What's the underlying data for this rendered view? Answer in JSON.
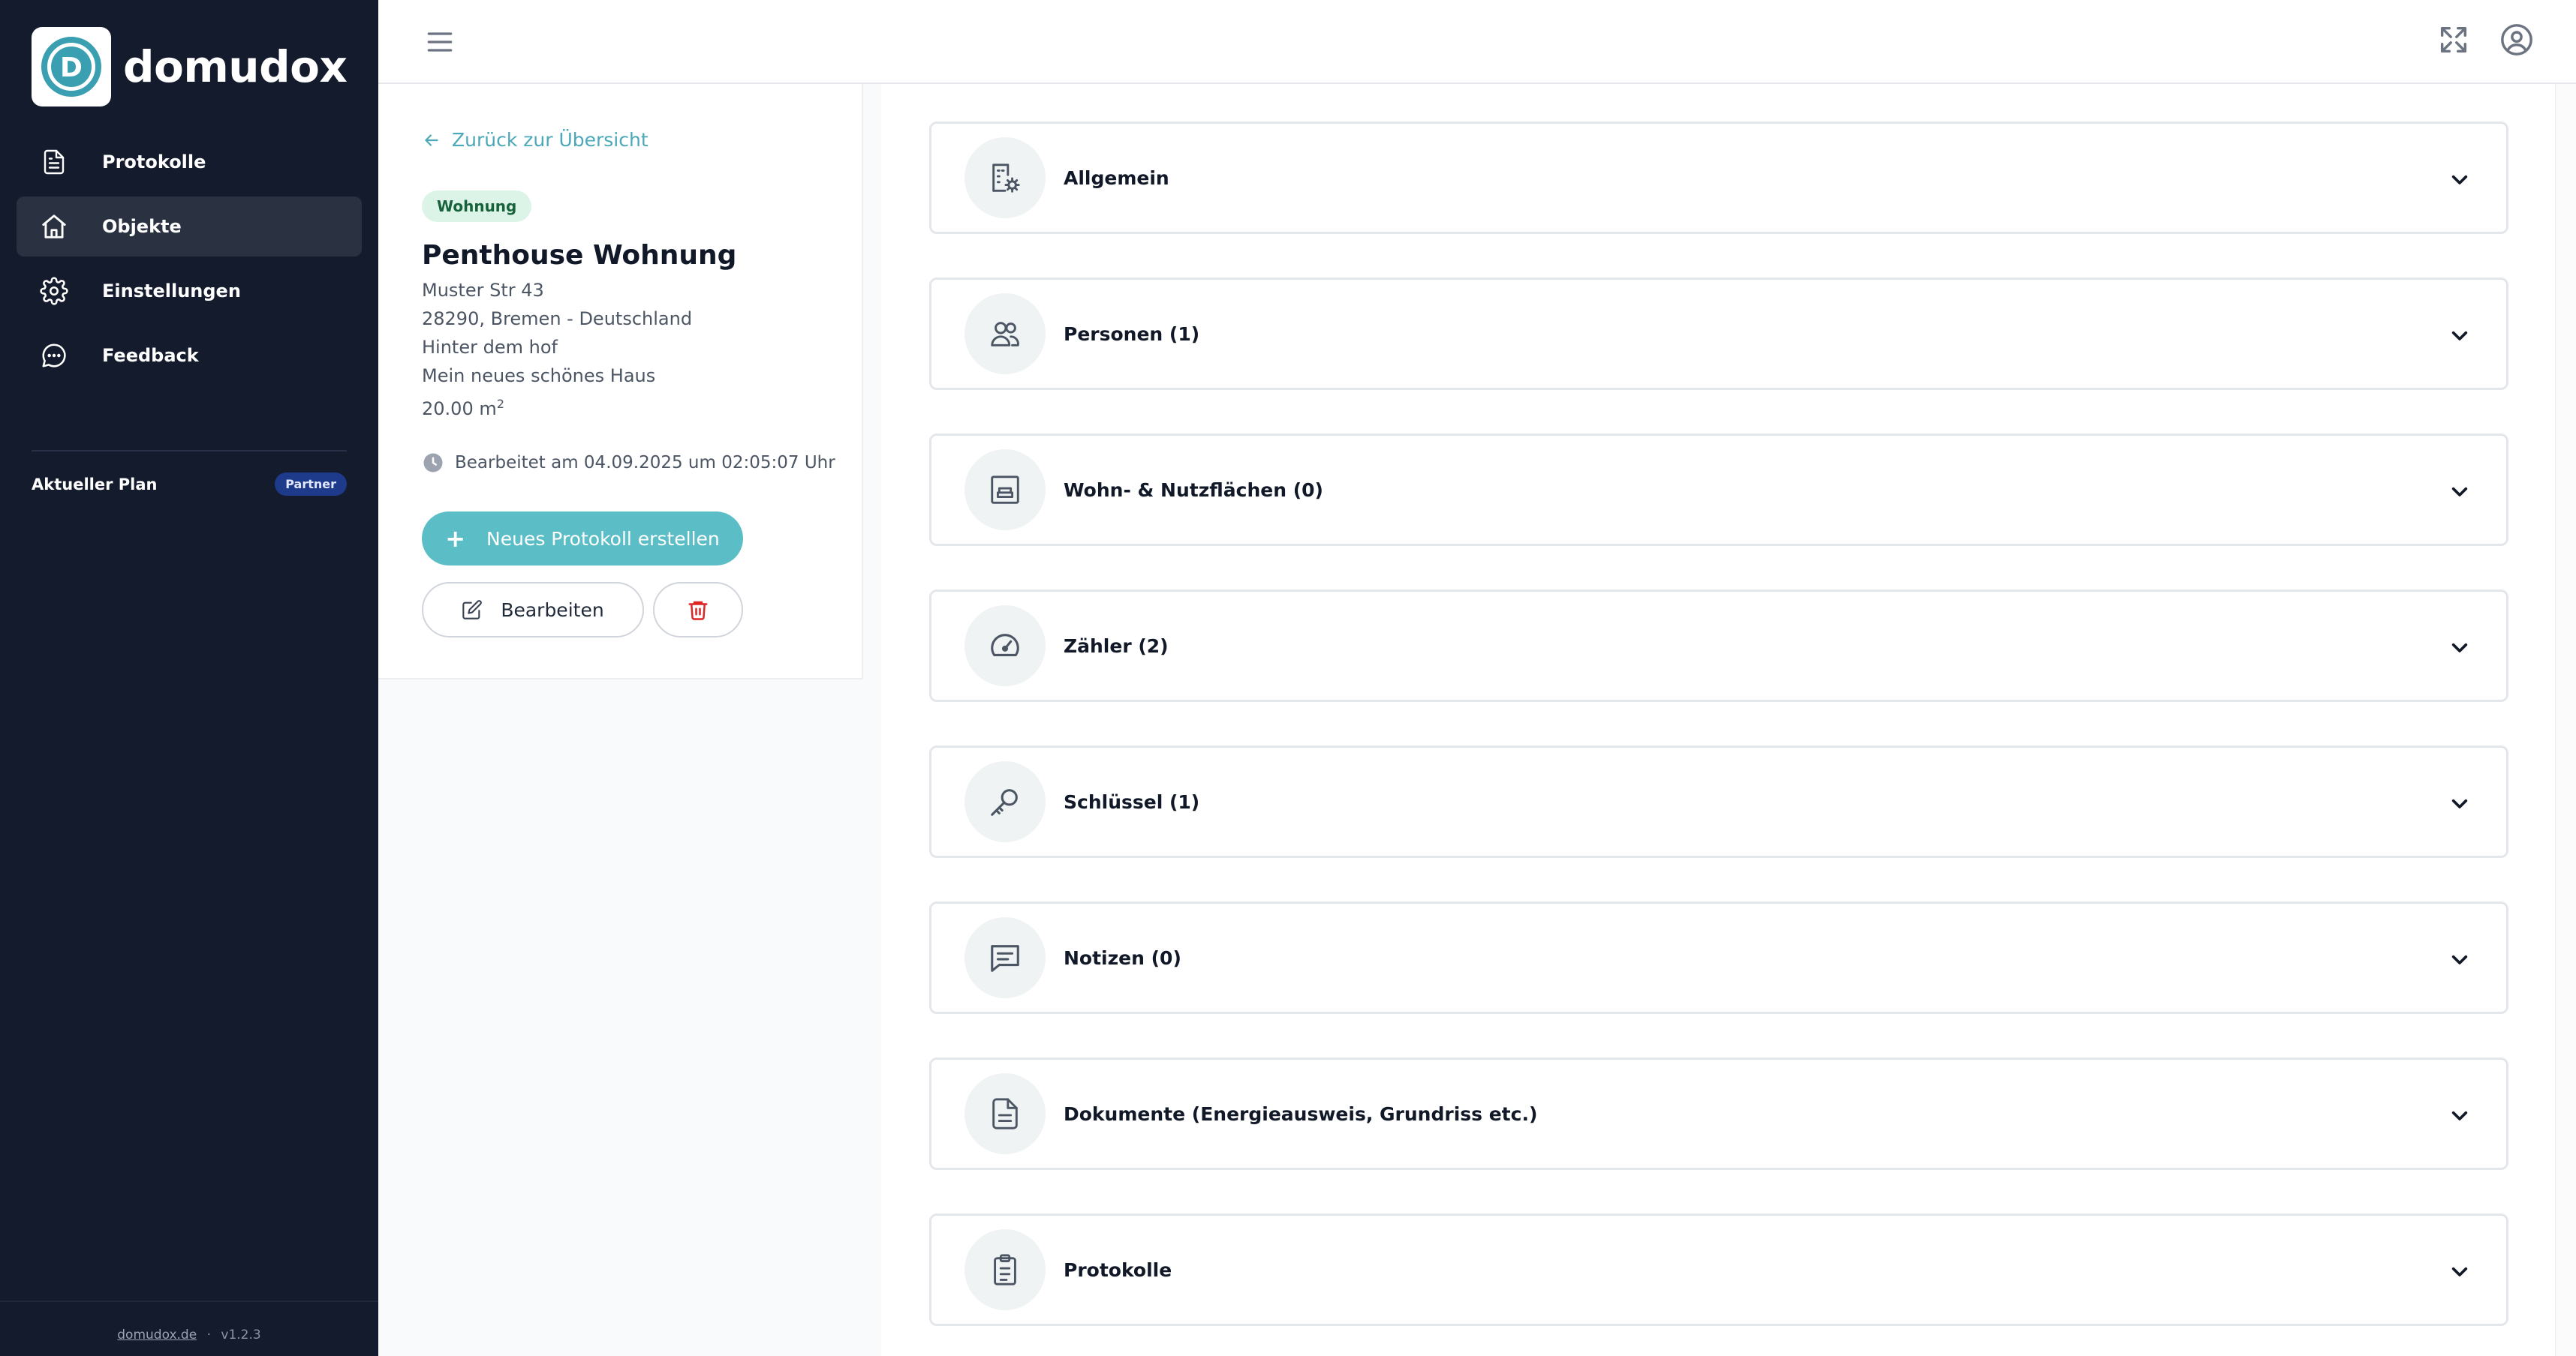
{
  "brand": {
    "name": "domudox",
    "logo_letter": "D"
  },
  "sidebar": {
    "items": [
      {
        "label": "Protokolle",
        "icon": "document-icon"
      },
      {
        "label": "Objekte",
        "icon": "home-icon",
        "active": true
      },
      {
        "label": "Einstellungen",
        "icon": "gear-icon"
      },
      {
        "label": "Feedback",
        "icon": "chat-icon"
      }
    ],
    "plan_label": "Aktueller Plan",
    "plan_badge": "Partner",
    "footer_link": "domudox.de",
    "footer_sep": "·",
    "version": "v1.2.3"
  },
  "header": {
    "menu_icon": "hamburger-icon",
    "fullscreen_icon": "fullscreen-icon",
    "account_icon": "user-circle-icon"
  },
  "object": {
    "back_link": "Zurück zur Übersicht",
    "type": "Wohnung",
    "title": "Penthouse Wohnung",
    "street": "Muster Str 43",
    "city_line": "28290, Bremen - Deutschland",
    "extra_1": "Hinter dem hof",
    "extra_2": "Mein neues schönes Haus",
    "area_value": "20.00 m",
    "area_unit_sup": "2",
    "edited": "Bearbeitet am 04.09.2025 um 02:05:07 Uhr",
    "new_protocol_button": "Neues Protokoll erstellen",
    "edit_button": "Bearbeiten"
  },
  "sections": [
    {
      "label": "Allgemein",
      "icon": "building-settings-icon"
    },
    {
      "label": "Personen (1)",
      "icon": "users-icon"
    },
    {
      "label": "Wohn- & Nutzflächen (0)",
      "icon": "room-icon"
    },
    {
      "label": "Zähler (2)",
      "icon": "gauge-icon"
    },
    {
      "label": "Schlüssel (1)",
      "icon": "key-icon"
    },
    {
      "label": "Notizen (0)",
      "icon": "note-icon"
    },
    {
      "label": "Dokumente (Energieausweis, Grundriss etc.)",
      "icon": "document-icon"
    },
    {
      "label": "Protokolle",
      "icon": "clipboard-icon"
    }
  ],
  "colors": {
    "sidebar_bg": "#141b2d",
    "accent": "#5bbdc5",
    "badge_green_bg": "#dcf3e7",
    "delete_red": "#dc2626",
    "plan_badge_bg": "#1e3a8a"
  }
}
